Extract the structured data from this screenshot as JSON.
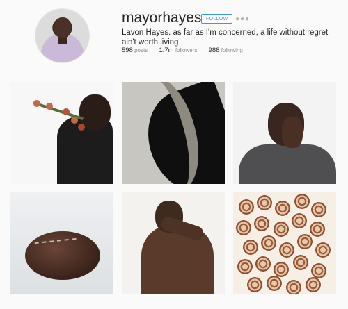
{
  "profile": {
    "username": "mayorhayes",
    "follow_label": "FOLLOW",
    "more_icon": "more-icon",
    "bio": "Lavon Hayes. as far as I'm concerned, a life without regret ain't worth living",
    "stats": {
      "posts_value": "598",
      "posts_label": "posts",
      "followers_value": "1.7m",
      "followers_label": "followers",
      "following_value": "988",
      "following_label": "following"
    }
  },
  "colors": {
    "accent": "#3897f0",
    "background": "#fafafa",
    "text": "#262626",
    "muted": "#8e8e8e"
  },
  "posts": [
    {
      "name": "man-with-flowers"
    },
    {
      "name": "spiked-tail-shadow"
    },
    {
      "name": "man-hand-on-face"
    },
    {
      "name": "american-football"
    },
    {
      "name": "bare-back-man"
    },
    {
      "name": "cinnamon-rolls"
    }
  ]
}
